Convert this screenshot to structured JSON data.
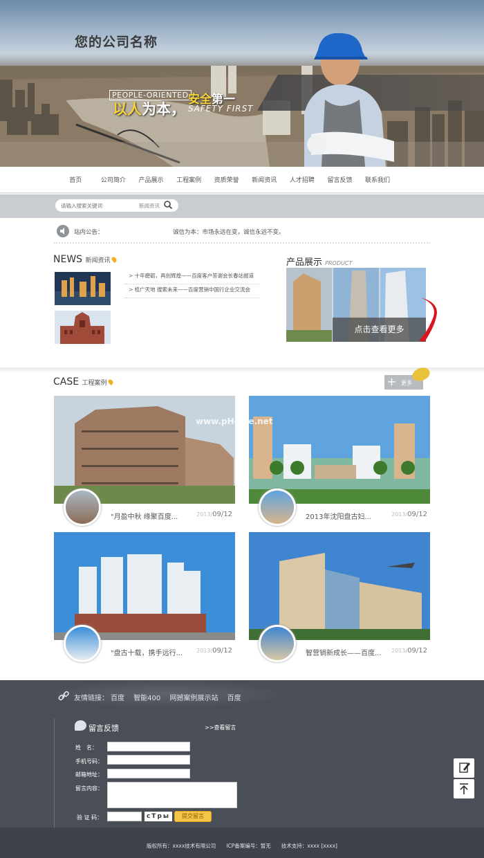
{
  "header": {
    "brand": "您的公司名称",
    "slogan_en": "PEOPLE-ORIENTED",
    "slogan_cn_yellow": "以人",
    "slogan_cn_white1": "为本，",
    "slogan_cn_yellow2": "安全",
    "slogan_cn_white2": "第一",
    "slogan_safety": "SAFETY FIRST"
  },
  "nav": [
    "首页",
    "公司简介",
    "产品展示",
    "工程案例",
    "资质荣誉",
    "新闻资讯",
    "人才招聘",
    "留言反馈",
    "联系我们"
  ],
  "search": {
    "placeholder": "请输入搜索关键词",
    "scope": "新闻资讯"
  },
  "notice": {
    "label": "站内公告：",
    "text": "诚信为本：市场永远在变，诚信永远不变。"
  },
  "news": {
    "title": "NEWS",
    "subtitle": "新闻资讯",
    "items": [
      "十年磨砺，再创辉煌——百度客户答谢会长春站报道",
      "桂广天地 搜索未来——百度营销中国行企业交流会"
    ]
  },
  "products": {
    "title": "产品展示",
    "subtitle": "PRODUCT",
    "more": "点击查看更多"
  },
  "cases": {
    "title": "CASE",
    "subtitle": "工程案例",
    "more": "更多",
    "watermark": "www.pHome.net",
    "items": [
      {
        "title": "\"月盈中秋 缘聚百度...",
        "year": "2013/",
        "date": "09/12"
      },
      {
        "title": "2013年沈阳盘古妇...",
        "year": "2013/",
        "date": "09/12"
      },
      {
        "title": "\"盘古十载，携手远行...",
        "year": "2013/",
        "date": "09/12"
      },
      {
        "title": "智营销新成长——百度...",
        "year": "2013/",
        "date": "09/12"
      }
    ]
  },
  "footer": {
    "links_label": "友情链接：",
    "links": [
      "百度",
      "智能400",
      "网撼案例展示站",
      "百度"
    ],
    "msg_title": "留言反馈",
    "msg_view": ">>查看留言",
    "form": {
      "name_label": "姓　名：",
      "phone_label": "手机号码：",
      "email_label": "邮箱地址：",
      "content_label": "留言内容：",
      "captcha_label": "验 证 码：",
      "captcha": "cTpы",
      "submit": "提交留言"
    },
    "copyright": "版权所有：xxxx技术有限公司　　ICP备案编号：暂无　　技术支持：xxxx [xxxx]"
  }
}
